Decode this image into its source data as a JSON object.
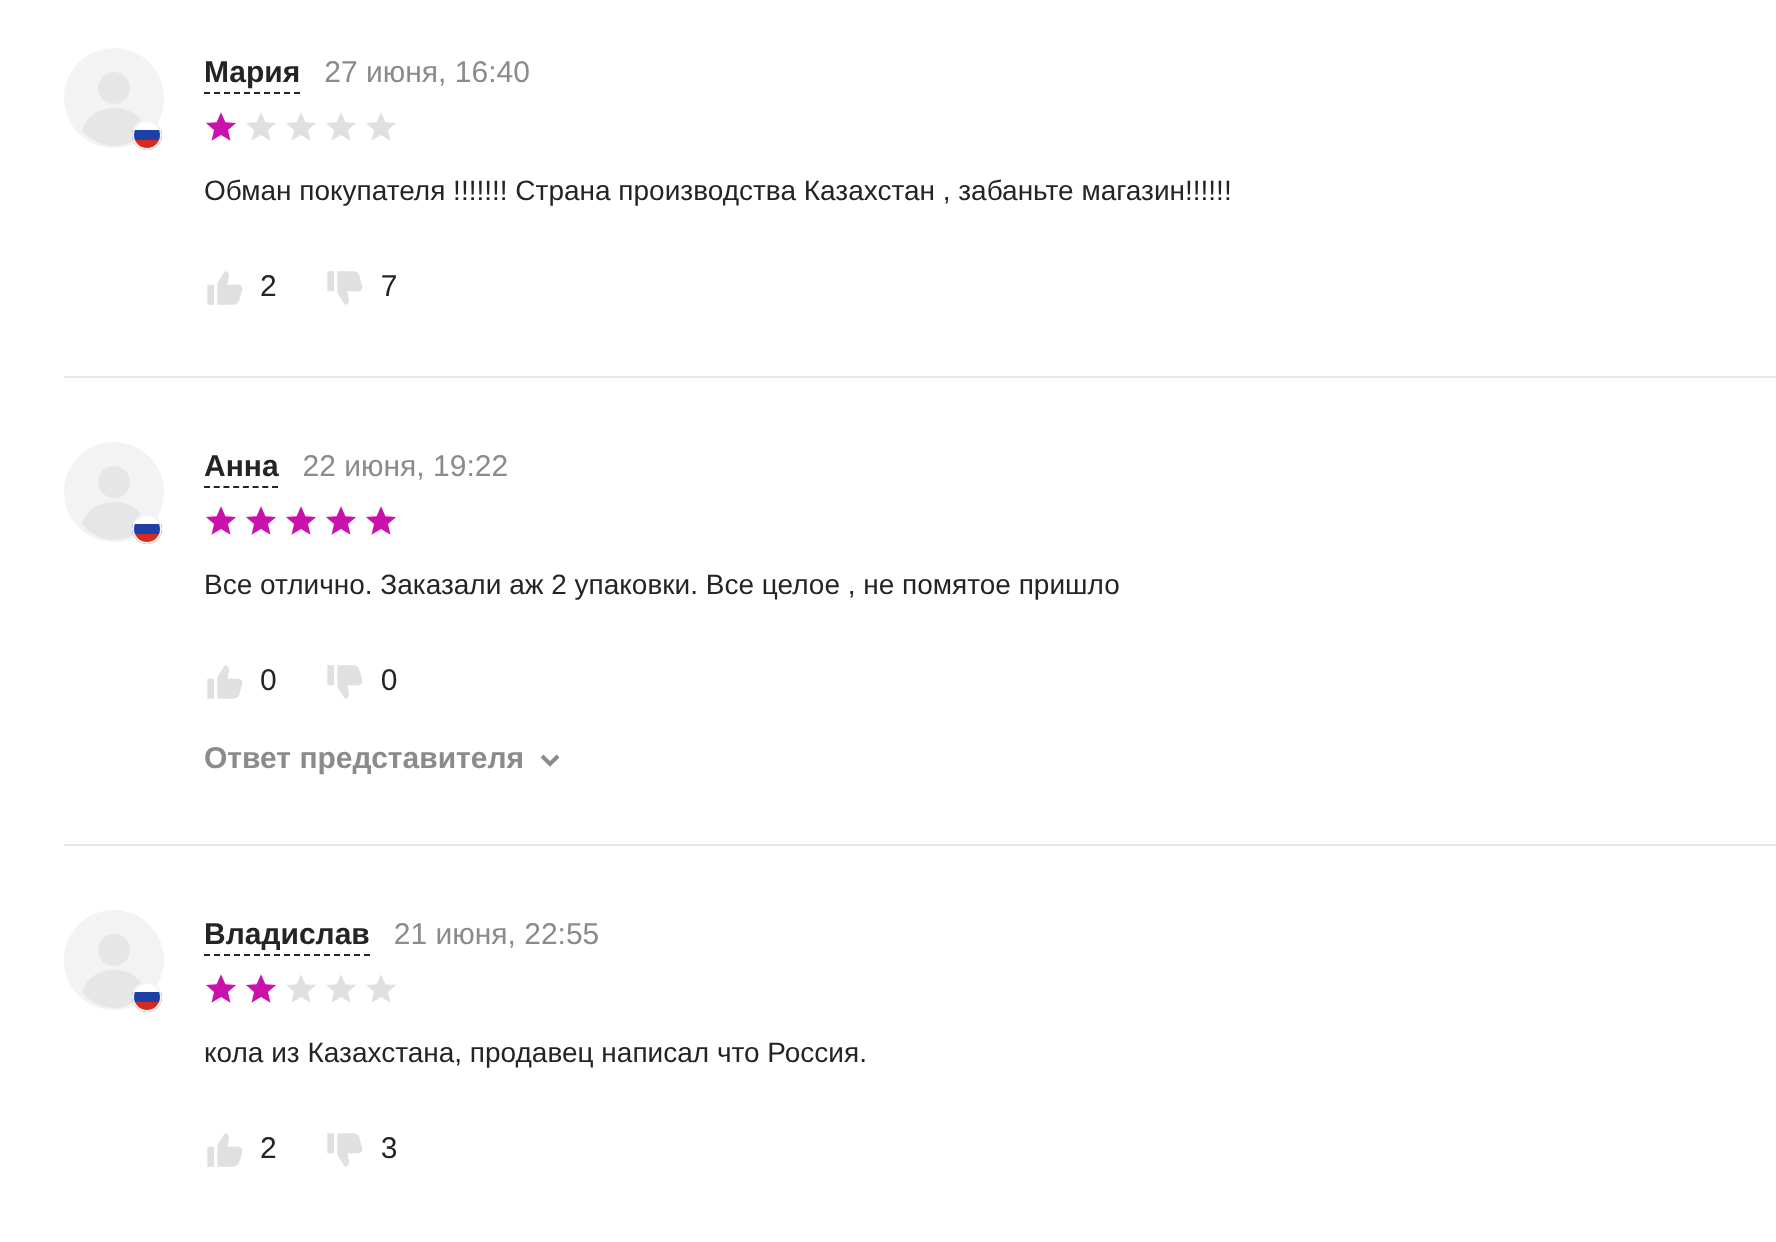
{
  "reviews": [
    {
      "author": "Мария",
      "date": "27 июня, 16:40",
      "stars": 1,
      "text": "Обман покупателя !!!!!!! Страна производства Казахстан , забаньте магазин!!!!!!",
      "likes": "2",
      "dislikes": "7"
    },
    {
      "author": "Анна",
      "date": "22 июня, 19:22",
      "stars": 5,
      "text": "Все отлично. Заказали аж 2 упаковки. Все целое , не помятое пришло",
      "likes": "0",
      "dislikes": "0",
      "reply_link": "Ответ представителя"
    },
    {
      "author": "Владислав",
      "date": "21 июня, 22:55",
      "stars": 2,
      "text": "кола из Казахстана, продавец написал что Россия.",
      "likes": "2",
      "dislikes": "3"
    }
  ]
}
